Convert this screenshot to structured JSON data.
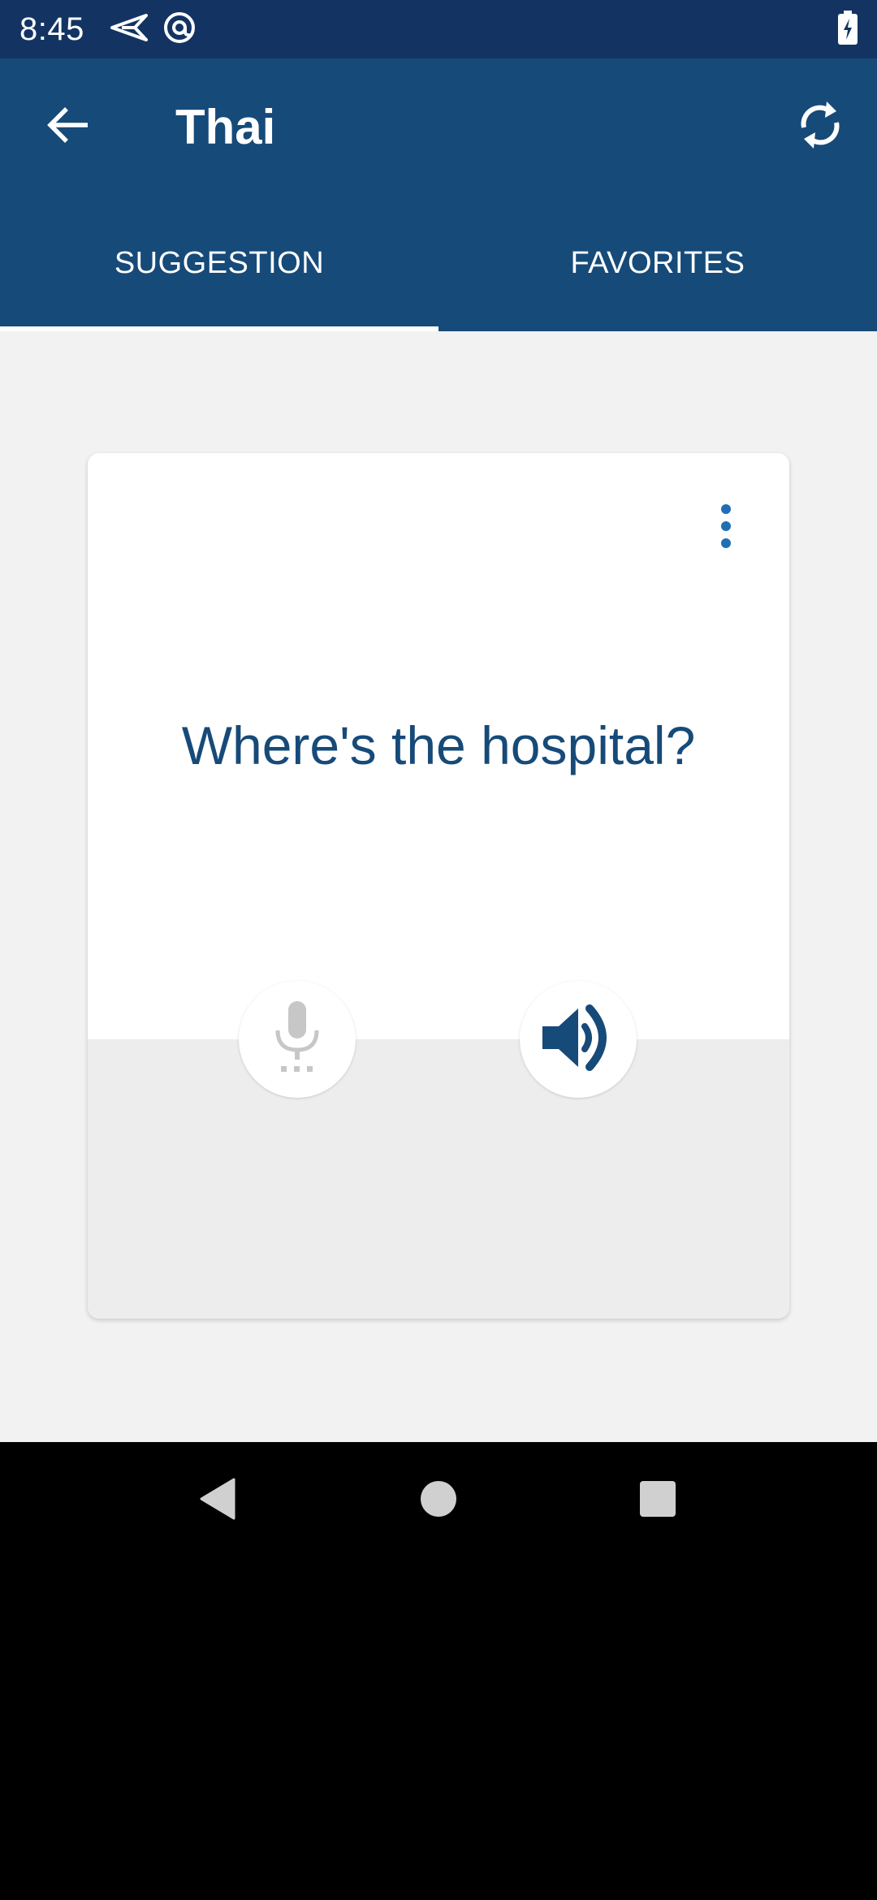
{
  "status_bar": {
    "time": "8:45",
    "icons": [
      "send-icon",
      "at-sign-icon",
      "battery-charging-icon"
    ]
  },
  "app_bar": {
    "title": "Thai",
    "back_icon": "arrow-left-icon",
    "refresh_icon": "refresh-icon"
  },
  "tabs": [
    {
      "label": "SUGGESTION",
      "selected": true
    },
    {
      "label": "FAVORITES",
      "selected": false
    }
  ],
  "card": {
    "phrase": "Where's the hospital?",
    "menu_icon": "more-vertical-icon",
    "mic_icon": "microphone-icon",
    "speaker_icon": "speaker-icon"
  },
  "colors": {
    "status_bar": "#133463",
    "app_bar": "#164a79",
    "accent": "#1e6fb5",
    "background": "#f2f2f2"
  }
}
